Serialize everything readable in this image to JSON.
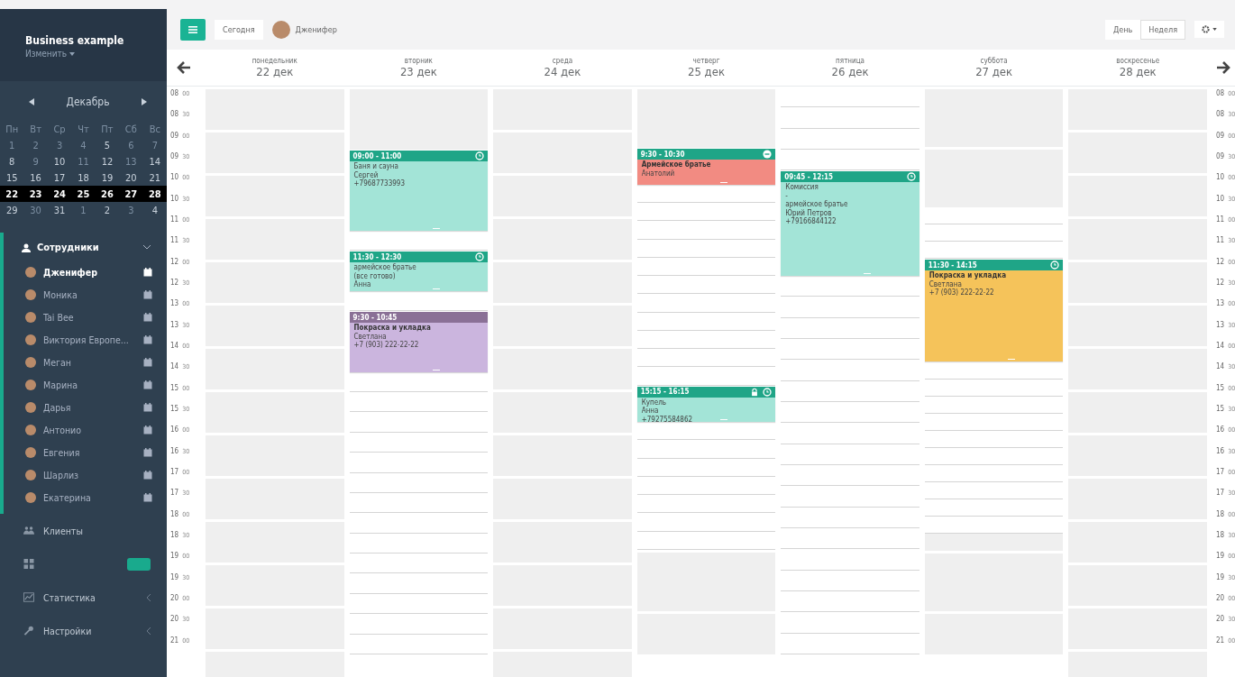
{
  "sidebar": {
    "business": "Business example",
    "change": "Изменить",
    "month": "Декабрь",
    "weekdays": [
      "Пн",
      "Вт",
      "Ср",
      "Чт",
      "Пт",
      "Сб",
      "Вс"
    ],
    "weeks": [
      {
        "selected": false,
        "days": [
          {
            "label": "1",
            "muted": true
          },
          {
            "label": "2",
            "muted": true
          },
          {
            "label": "3",
            "muted": true
          },
          {
            "label": "4",
            "muted": true
          },
          {
            "label": "5",
            "muted": false
          },
          {
            "label": "6",
            "muted": true
          },
          {
            "label": "7",
            "muted": true
          }
        ]
      },
      {
        "selected": false,
        "days": [
          {
            "label": "8",
            "muted": false
          },
          {
            "label": "9",
            "muted": true
          },
          {
            "label": "10",
            "muted": false
          },
          {
            "label": "11",
            "muted": true
          },
          {
            "label": "12",
            "muted": false
          },
          {
            "label": "13",
            "muted": true
          },
          {
            "label": "14",
            "muted": false
          }
        ]
      },
      {
        "selected": false,
        "days": [
          {
            "label": "15",
            "muted": false
          },
          {
            "label": "16",
            "muted": false
          },
          {
            "label": "17",
            "muted": false
          },
          {
            "label": "18",
            "muted": false
          },
          {
            "label": "19",
            "muted": false
          },
          {
            "label": "20",
            "muted": false
          },
          {
            "label": "21",
            "muted": false
          }
        ]
      },
      {
        "selected": true,
        "days": [
          {
            "label": "22",
            "muted": false
          },
          {
            "label": "23",
            "muted": false
          },
          {
            "label": "24",
            "muted": false
          },
          {
            "label": "25",
            "muted": false
          },
          {
            "label": "26",
            "muted": false
          },
          {
            "label": "27",
            "muted": false
          },
          {
            "label": "28",
            "muted": false
          }
        ]
      },
      {
        "selected": false,
        "days": [
          {
            "label": "29",
            "muted": false
          },
          {
            "label": "30",
            "muted": true
          },
          {
            "label": "31",
            "muted": false
          },
          {
            "label": "1",
            "muted": true
          },
          {
            "label": "2",
            "muted": false
          },
          {
            "label": "3",
            "muted": true
          },
          {
            "label": "4",
            "muted": false
          }
        ]
      }
    ],
    "staff_title": "Сотрудники",
    "staff_expanded": true,
    "staff": [
      {
        "name": "Дженифер",
        "selected": true
      },
      {
        "name": "Моника",
        "selected": false
      },
      {
        "name": "Tai Bee",
        "selected": false
      },
      {
        "name": "Виктория Европе...",
        "selected": false
      },
      {
        "name": "Меган",
        "selected": false
      },
      {
        "name": "Марина",
        "selected": false
      },
      {
        "name": "Дарья",
        "selected": false
      },
      {
        "name": "Антонио",
        "selected": false
      },
      {
        "name": "Евгения",
        "selected": false
      },
      {
        "name": "Шарлиз",
        "selected": false
      },
      {
        "name": "Екатерина",
        "selected": false
      }
    ],
    "menu": [
      {
        "kind": "users",
        "label": "Клиенты"
      },
      {
        "kind": "grid",
        "badge": true
      },
      {
        "kind": "chart",
        "label": "Статистика",
        "chevron": true
      },
      {
        "kind": "wrench",
        "label": "Настройки",
        "chevron": true
      }
    ]
  },
  "toolbar": {
    "today": "Сегодня",
    "user": "Дженифер",
    "views": [
      {
        "label": "День",
        "selected": false
      },
      {
        "label": "Неделя",
        "selected": true
      }
    ]
  },
  "time_labels_left": [
    {
      "hour": "08",
      "minutes": "00"
    },
    {
      "hour": "08",
      "minutes": "30"
    },
    {
      "hour": "09",
      "minutes": "00"
    },
    {
      "hour": "09",
      "minutes": "30"
    },
    {
      "hour": "10",
      "minutes": "00"
    },
    {
      "hour": "10",
      "minutes": "30"
    },
    {
      "hour": "11",
      "minutes": "00"
    },
    {
      "hour": "11",
      "minutes": "30"
    },
    {
      "hour": "12",
      "minutes": "00"
    },
    {
      "hour": "12",
      "minutes": "30"
    },
    {
      "hour": "13",
      "minutes": "00"
    },
    {
      "hour": "13",
      "minutes": "30"
    },
    {
      "hour": "14",
      "minutes": "00"
    },
    {
      "hour": "14",
      "minutes": "30"
    },
    {
      "hour": "15",
      "minutes": "00"
    },
    {
      "hour": "15",
      "minutes": "30"
    },
    {
      "hour": "16",
      "minutes": "00"
    },
    {
      "hour": "16",
      "minutes": "30"
    },
    {
      "hour": "17",
      "minutes": "00"
    },
    {
      "hour": "17",
      "minutes": "30"
    },
    {
      "hour": "18",
      "minutes": "00"
    },
    {
      "hour": "18",
      "minutes": "30"
    },
    {
      "hour": "19",
      "minutes": "00"
    },
    {
      "hour": "19",
      "minutes": "30"
    },
    {
      "hour": "20",
      "minutes": "00"
    },
    {
      "hour": "20",
      "minutes": "30"
    },
    {
      "hour": "21",
      "minutes": "00"
    }
  ],
  "time_labels_right": [
    {
      "hour": "08",
      "minutes": "00"
    },
    {
      "hour": "08",
      "minutes": "30"
    },
    {
      "hour": "09",
      "minutes": "00"
    },
    {
      "hour": "09",
      "minutes": "30"
    },
    {
      "hour": "10",
      "minutes": "00"
    },
    {
      "hour": "10",
      "minutes": "30"
    },
    {
      "hour": "11",
      "minutes": "00"
    },
    {
      "hour": "11",
      "minutes": "30"
    },
    {
      "hour": "12",
      "minutes": "00"
    },
    {
      "hour": "12",
      "minutes": "30"
    },
    {
      "hour": "13",
      "minutes": "00"
    },
    {
      "hour": "13",
      "minutes": "30"
    },
    {
      "hour": "14",
      "minutes": "00"
    },
    {
      "hour": "14",
      "minutes": "30"
    },
    {
      "hour": "15",
      "minutes": "00"
    },
    {
      "hour": "15",
      "minutes": "30"
    },
    {
      "hour": "16",
      "minutes": "00"
    },
    {
      "hour": "16",
      "minutes": "30"
    },
    {
      "hour": "17",
      "minutes": "00"
    },
    {
      "hour": "17",
      "minutes": "30"
    },
    {
      "hour": "18",
      "minutes": "00"
    },
    {
      "hour": "18",
      "minutes": "30"
    },
    {
      "hour": "19",
      "minutes": "00"
    },
    {
      "hour": "19",
      "minutes": "30"
    },
    {
      "hour": "20",
      "minutes": "00"
    },
    {
      "hour": "20",
      "minutes": "30"
    },
    {
      "hour": "21",
      "minutes": "00"
    }
  ],
  "days": [
    {
      "weekday": "понедельник",
      "date": "22 дек",
      "slots": [
        {
          "kind": "closed"
        },
        {
          "kind": "closed"
        },
        {
          "kind": "closed"
        },
        {
          "kind": "closed"
        },
        {
          "kind": "closed"
        },
        {
          "kind": "closed"
        },
        {
          "kind": "closed"
        },
        {
          "kind": "closed"
        },
        {
          "kind": "closed"
        },
        {
          "kind": "closed"
        },
        {
          "kind": "closed"
        },
        {
          "kind": "closed"
        },
        {
          "kind": "closed"
        },
        {
          "kind": "closed"
        },
        {
          "kind": "closed"
        },
        {
          "kind": "closed"
        },
        {
          "kind": "closed"
        },
        {
          "kind": "closed"
        },
        {
          "kind": "closed"
        },
        {
          "kind": "closed"
        },
        {
          "kind": "closed"
        },
        {
          "kind": "closed"
        },
        {
          "kind": "closed"
        },
        {
          "kind": "closed"
        },
        {
          "kind": "closed"
        },
        {
          "kind": "closed"
        },
        {
          "kind": "closed"
        }
      ]
    },
    {
      "weekday": "вторник",
      "date": "23 дек",
      "slots": [
        {
          "kind": "closed"
        },
        {
          "kind": "closed"
        },
        {
          "kind": "event"
        },
        {
          "kind": "cont"
        },
        {
          "kind": "cont"
        },
        {
          "kind": "cont"
        },
        {
          "kind": "open"
        },
        {
          "kind": "event"
        },
        {
          "kind": "cont"
        },
        {
          "kind": "open"
        },
        {
          "kind": "event"
        },
        {
          "kind": "cont"
        },
        {
          "kind": "cont"
        },
        {
          "kind": "open"
        },
        {
          "kind": "open"
        },
        {
          "kind": "open"
        },
        {
          "kind": "open"
        },
        {
          "kind": "open"
        },
        {
          "kind": "open"
        },
        {
          "kind": "open"
        },
        {
          "kind": "open"
        },
        {
          "kind": "open"
        },
        {
          "kind": "open"
        },
        {
          "kind": "open"
        },
        {
          "kind": "open"
        },
        {
          "kind": "open"
        },
        {
          "kind": "open"
        }
      ],
      "events": [
        {
          "time": "09:00 - 11:00",
          "color": "#a3e4d7",
          "header": {
            "color": "#1fa587"
          },
          "icons": [
            {
              "kind": "clock"
            }
          ],
          "lines": [
            "Баня и сауна",
            "Сергей",
            "+79687733993"
          ]
        },
        {
          "time": "11:30 - 12:30",
          "color": "#a3e4d7",
          "header": {
            "color": "#1fa587"
          },
          "icons": [
            {
              "kind": "clock"
            }
          ],
          "lines": [
            "армейское братье",
            "(все готово)",
            "Анна"
          ]
        },
        {
          "time": "9:30 - 10:45",
          "color": "#cbb5de",
          "header": {
            "color": "#8a7096"
          },
          "title": "Покраска и укладка",
          "lines": [
            "Светлана",
            "+7 (903) 222-22-22"
          ]
        }
      ]
    },
    {
      "weekday": "среда",
      "date": "24 дек",
      "slots": [
        {
          "kind": "closed"
        },
        {
          "kind": "closed"
        },
        {
          "kind": "closed"
        },
        {
          "kind": "closed"
        },
        {
          "kind": "closed"
        },
        {
          "kind": "closed"
        },
        {
          "kind": "closed"
        },
        {
          "kind": "closed"
        },
        {
          "kind": "closed"
        },
        {
          "kind": "closed"
        },
        {
          "kind": "closed"
        },
        {
          "kind": "closed"
        },
        {
          "kind": "closed"
        },
        {
          "kind": "closed"
        },
        {
          "kind": "closed"
        },
        {
          "kind": "closed"
        },
        {
          "kind": "closed"
        },
        {
          "kind": "closed"
        },
        {
          "kind": "closed"
        },
        {
          "kind": "closed"
        },
        {
          "kind": "closed"
        },
        {
          "kind": "closed"
        },
        {
          "kind": "closed"
        },
        {
          "kind": "closed"
        },
        {
          "kind": "closed"
        },
        {
          "kind": "closed"
        },
        {
          "kind": "closed"
        }
      ]
    },
    {
      "weekday": "четверг",
      "date": "25 дек",
      "slots": [
        {
          "kind": "closed"
        },
        {
          "kind": "closed"
        },
        {
          "kind": "event"
        },
        {
          "kind": "cont"
        },
        {
          "kind": "open"
        },
        {
          "kind": "open"
        },
        {
          "kind": "open"
        },
        {
          "kind": "open"
        },
        {
          "kind": "open"
        },
        {
          "kind": "open"
        },
        {
          "kind": "open"
        },
        {
          "kind": "open"
        },
        {
          "kind": "open"
        },
        {
          "kind": "open"
        },
        {
          "kind": "open"
        },
        {
          "kind": "event"
        },
        {
          "kind": "cont"
        },
        {
          "kind": "open"
        },
        {
          "kind": "open"
        },
        {
          "kind": "open"
        },
        {
          "kind": "open"
        },
        {
          "kind": "open"
        },
        {
          "kind": "open"
        },
        {
          "kind": "open"
        },
        {
          "kind": "closed"
        },
        {
          "kind": "closed"
        },
        {
          "kind": "closed"
        }
      ],
      "events": [
        {
          "time": "9:30 - 10:30",
          "color": "#f28b82",
          "header": {
            "color": "#1fa587"
          },
          "icons": [
            {
              "kind": "minus"
            }
          ],
          "title": "Армейское братье",
          "lines": [
            "Анатолий"
          ]
        },
        {
          "time": "15:15 - 16:15",
          "color": "#a3e4d7",
          "header": {
            "color": "#1fa587"
          },
          "icons": [
            {
              "kind": "lock"
            },
            {
              "kind": "clock"
            }
          ],
          "lines": [
            "Купель",
            "Анна",
            "+79275584862"
          ]
        }
      ]
    },
    {
      "weekday": "пятница",
      "date": "26 дек",
      "slots": [
        {
          "kind": "open"
        },
        {
          "kind": "open"
        },
        {
          "kind": "open"
        },
        {
          "kind": "open"
        },
        {
          "kind": "event"
        },
        {
          "kind": "cont"
        },
        {
          "kind": "cont"
        },
        {
          "kind": "cont"
        },
        {
          "kind": "cont"
        },
        {
          "kind": "open"
        },
        {
          "kind": "open"
        },
        {
          "kind": "open"
        },
        {
          "kind": "open"
        },
        {
          "kind": "open"
        },
        {
          "kind": "open"
        },
        {
          "kind": "open"
        },
        {
          "kind": "open"
        },
        {
          "kind": "open"
        },
        {
          "kind": "open"
        },
        {
          "kind": "open"
        },
        {
          "kind": "open"
        },
        {
          "kind": "open"
        },
        {
          "kind": "open"
        },
        {
          "kind": "open"
        },
        {
          "kind": "open"
        },
        {
          "kind": "open"
        },
        {
          "kind": "open"
        }
      ],
      "events": [
        {
          "time": "09:45 - 12:15",
          "color": "#a3e4d7",
          "header": {
            "color": "#1fa587"
          },
          "icons": [
            {
              "kind": "clock"
            }
          ],
          "lines": [
            "Комиссия",
            "-",
            "армейское братье",
            "Юрий Петров",
            "+79166844122"
          ]
        }
      ]
    },
    {
      "weekday": "суббота",
      "date": "27 дек",
      "slots": [
        {
          "kind": "closed"
        },
        {
          "kind": "closed"
        },
        {
          "kind": "closed"
        },
        {
          "kind": "closed"
        },
        {
          "kind": "open"
        },
        {
          "kind": "open"
        },
        {
          "kind": "open"
        },
        {
          "kind": "event"
        },
        {
          "kind": "cont"
        },
        {
          "kind": "cont"
        },
        {
          "kind": "cont"
        },
        {
          "kind": "cont"
        },
        {
          "kind": "cont"
        },
        {
          "kind": "open"
        },
        {
          "kind": "open"
        },
        {
          "kind": "open"
        },
        {
          "kind": "open"
        },
        {
          "kind": "open"
        },
        {
          "kind": "open"
        },
        {
          "kind": "open"
        },
        {
          "kind": "open"
        },
        {
          "kind": "open"
        },
        {
          "kind": "open"
        },
        {
          "kind": "closed"
        },
        {
          "kind": "closed"
        },
        {
          "kind": "closed"
        },
        {
          "kind": "closed"
        }
      ],
      "events": [
        {
          "time": "11:30 - 14:15",
          "color": "#f5c35a",
          "header": {
            "color": "#1fa587"
          },
          "icons": [
            {
              "kind": "clock"
            }
          ],
          "title": "Покраска и укладка",
          "lines": [
            "Светлана",
            "+7 (903) 222-22-22"
          ]
        }
      ]
    },
    {
      "weekday": "воскресенье",
      "date": "28 дек",
      "slots": [
        {
          "kind": "closed"
        },
        {
          "kind": "closed"
        },
        {
          "kind": "closed"
        },
        {
          "kind": "closed"
        },
        {
          "kind": "closed"
        },
        {
          "kind": "closed"
        },
        {
          "kind": "closed"
        },
        {
          "kind": "closed"
        },
        {
          "kind": "closed"
        },
        {
          "kind": "closed"
        },
        {
          "kind": "closed"
        },
        {
          "kind": "closed"
        },
        {
          "kind": "closed"
        },
        {
          "kind": "closed"
        },
        {
          "kind": "closed"
        },
        {
          "kind": "closed"
        },
        {
          "kind": "closed"
        },
        {
          "kind": "closed"
        },
        {
          "kind": "closed"
        },
        {
          "kind": "closed"
        },
        {
          "kind": "closed"
        },
        {
          "kind": "closed"
        },
        {
          "kind": "closed"
        },
        {
          "kind": "closed"
        },
        {
          "kind": "closed"
        },
        {
          "kind": "closed"
        },
        {
          "kind": "closed"
        }
      ]
    }
  ]
}
